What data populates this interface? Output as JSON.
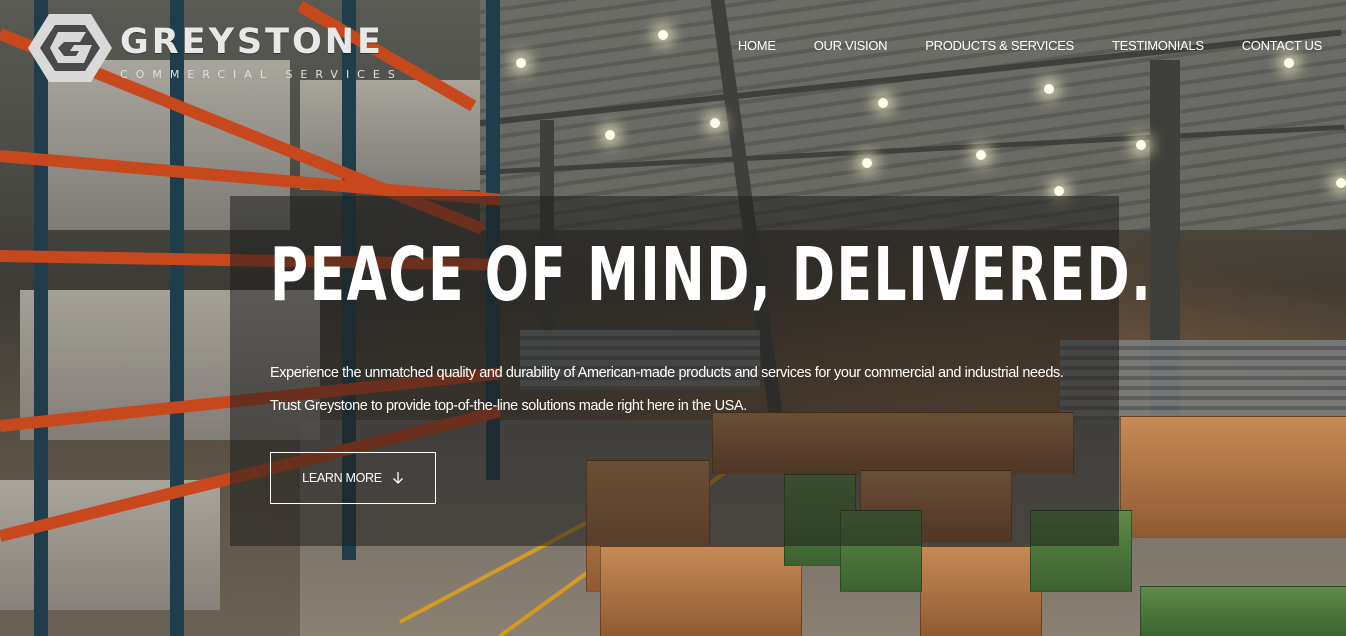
{
  "brand": {
    "name": "GREYSTONE",
    "tagline": "COMMERCIAL SERVICES"
  },
  "nav": {
    "items": [
      {
        "label": "HOME"
      },
      {
        "label": "OUR VISION"
      },
      {
        "label": "PRODUCTS & SERVICES"
      },
      {
        "label": "TESTIMONIALS"
      },
      {
        "label": "CONTACT US"
      }
    ]
  },
  "hero": {
    "headline": "PEACE OF MIND, DELIVERED.",
    "description_line1": "Experience the unmatched quality and durability of American-made products and services for your commercial and industrial needs.",
    "description_line2": "Trust Greystone to provide top-of-the-line solutions made right here in the USA.",
    "cta_label": "LEARN MORE",
    "cta_icon": "arrow-down-icon",
    "background": "warehouse-photo"
  },
  "colors": {
    "overlay": "#1e1e1e",
    "text": "#ffffff",
    "rack_orange": "#c8481e",
    "logo_grey": "#e8e8e8"
  }
}
